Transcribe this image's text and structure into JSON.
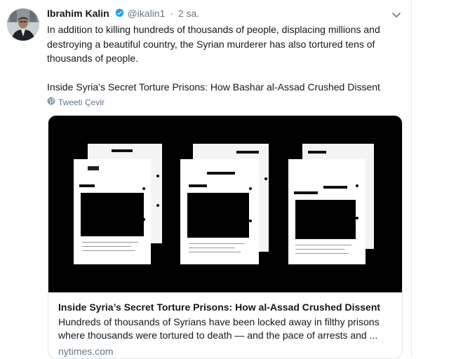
{
  "tweet": {
    "author_name": "Ibrahim Kalin",
    "handle": "@ikalin1",
    "separator": "·",
    "time": "2 sa.",
    "text_paragraph_1": "In addition to killing hundreds of thousands of people, displacing millions and destroying a beautiful country, the Syrian murderer has also tortured tens of thousands of people.",
    "text_paragraph_2": "Inside Syria’s Secret Torture Prisons: How Bashar al-Assad Crushed Dissent",
    "translate_label": "Tweeti Çevir"
  },
  "card": {
    "title": "Inside Syria’s Secret Torture Prisons: How al-Assad Crushed Dissent",
    "description_line_1": "Hundreds of thousands of Syrians have been locked away in filthy prisons",
    "description_line_2": "where thousands were tortured to death — and the pace of arrests and ...",
    "domain": "nytimes.com"
  },
  "colors": {
    "verified_blue": "#1da1f2",
    "secondary_text": "#657786",
    "card_border": "#e1e8ed"
  }
}
